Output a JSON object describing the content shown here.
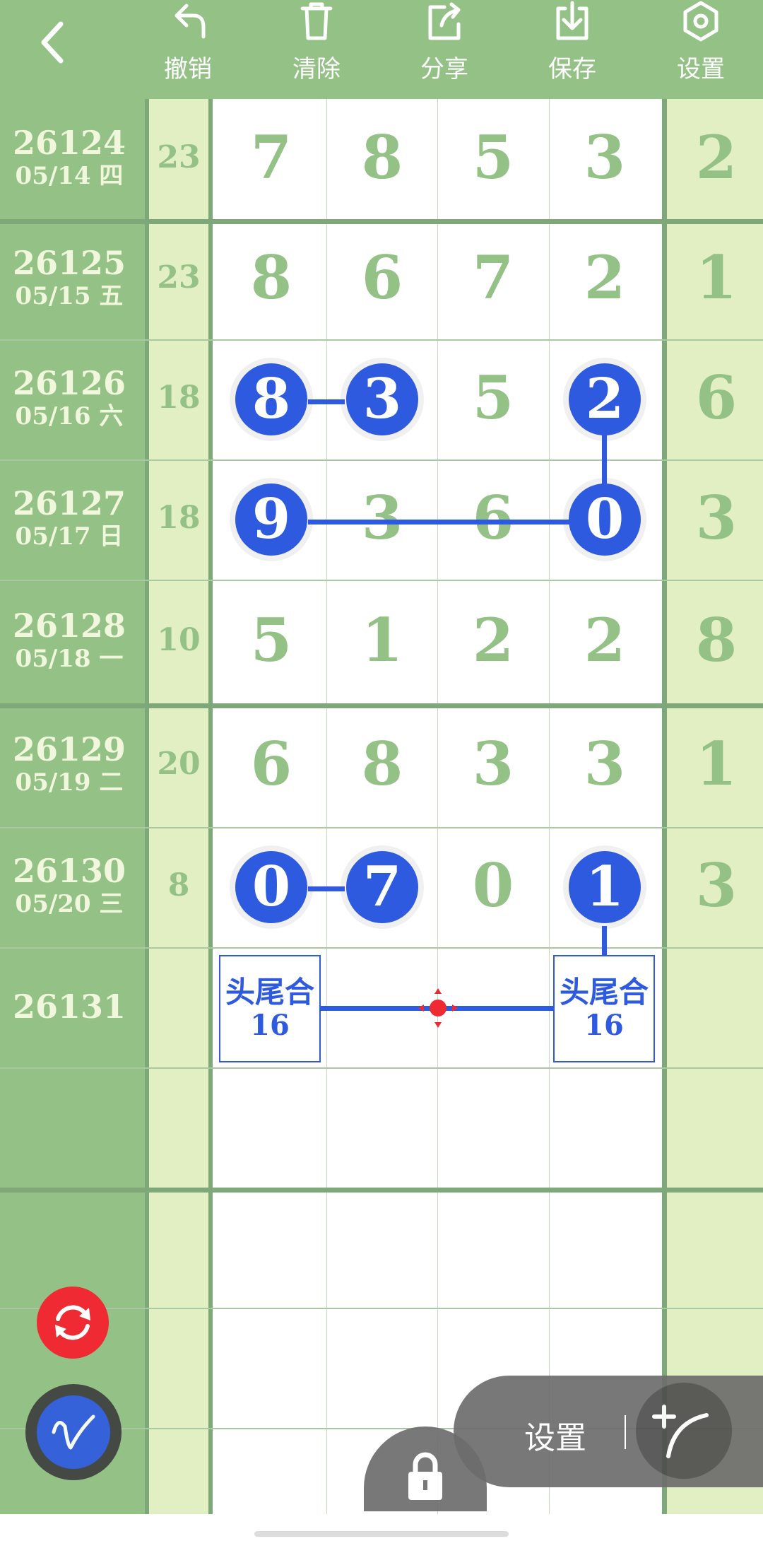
{
  "toolbar": {
    "back": "back",
    "items": [
      {
        "label": "撤销",
        "icon": "undo-icon"
      },
      {
        "label": "清除",
        "icon": "trash-icon"
      },
      {
        "label": "分享",
        "icon": "share-icon"
      },
      {
        "label": "保存",
        "icon": "download-icon"
      },
      {
        "label": "设置",
        "icon": "gear-icon"
      }
    ]
  },
  "rows": [
    {
      "issue": "26124",
      "date": "05/14 四",
      "sum": "23",
      "digits": [
        "7",
        "8",
        "5",
        "3"
      ],
      "extra": "2"
    },
    {
      "issue": "26125",
      "date": "05/15 五",
      "sum": "23",
      "digits": [
        "8",
        "6",
        "7",
        "2"
      ],
      "extra": "1"
    },
    {
      "issue": "26126",
      "date": "05/16 六",
      "sum": "18",
      "digits": [
        "8",
        "3",
        "5",
        "2"
      ],
      "extra": "6"
    },
    {
      "issue": "26127",
      "date": "05/17 日",
      "sum": "18",
      "digits": [
        "9",
        "3",
        "6",
        "0"
      ],
      "extra": "3"
    },
    {
      "issue": "26128",
      "date": "05/18 一",
      "sum": "10",
      "digits": [
        "5",
        "1",
        "2",
        "2"
      ],
      "extra": "8"
    },
    {
      "issue": "26129",
      "date": "05/19 二",
      "sum": "20",
      "digits": [
        "6",
        "8",
        "3",
        "3"
      ],
      "extra": "1"
    },
    {
      "issue": "26130",
      "date": "05/20 三",
      "sum": "8",
      "digits": [
        "0",
        "7",
        "0",
        "1"
      ],
      "extra": "3"
    },
    {
      "issue": "26131",
      "date": "",
      "sum": "",
      "digits": [
        "",
        "",
        "",
        ""
      ],
      "extra": ""
    }
  ],
  "marked": [
    {
      "row": 2,
      "cols": [
        0,
        1,
        3
      ]
    },
    {
      "row": 3,
      "cols": [
        0,
        3
      ]
    },
    {
      "row": 6,
      "cols": [
        0,
        1,
        3
      ]
    }
  ],
  "prediction": {
    "label": "头尾合",
    "value": "16"
  },
  "colors": {
    "header": "#93c186",
    "ball": "#2e5ae0",
    "digit": "#93c186",
    "panel": "#e2efc2",
    "target": "#ef2a33"
  },
  "fab": {
    "refresh_icon": "refresh-icon",
    "pen_icon": "pen-icon",
    "settings_label": "设置",
    "add_line_icon": "add-line-icon",
    "lock_icon": "lock-icon"
  }
}
